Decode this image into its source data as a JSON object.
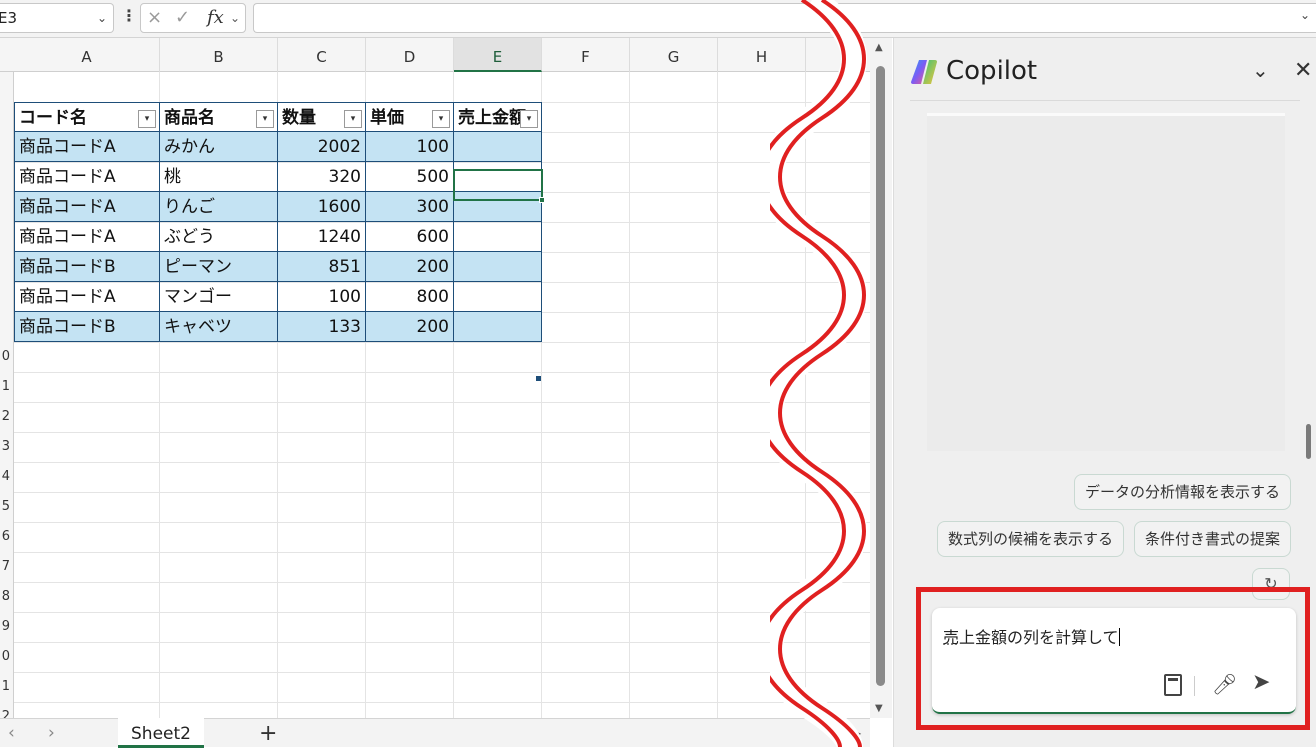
{
  "formula_bar": {
    "name_box": "E3",
    "cancel_icon": "×",
    "enter_icon": "✓",
    "fx_label": "fx",
    "formula": ""
  },
  "columns": [
    "A",
    "B",
    "C",
    "D",
    "E",
    "F",
    "G",
    "H"
  ],
  "row_numbers": [
    "",
    "",
    "",
    "",
    "",
    "",
    "",
    "",
    "0",
    "1",
    "2",
    "3",
    "4",
    "5",
    "6",
    "7",
    "8",
    "9",
    "0",
    "1",
    "2"
  ],
  "table": {
    "headers": [
      "コード名",
      "商品名",
      "数量",
      "単価",
      "売上金額"
    ],
    "rows": [
      [
        "商品コードA",
        "みかん",
        "2002",
        "100",
        ""
      ],
      [
        "商品コードA",
        "桃",
        "320",
        "500",
        ""
      ],
      [
        "商品コードA",
        "りんご",
        "1600",
        "300",
        ""
      ],
      [
        "商品コードA",
        "ぶどう",
        "1240",
        "600",
        ""
      ],
      [
        "商品コードB",
        "ピーマン",
        "851",
        "200",
        ""
      ],
      [
        "商品コードA",
        "マンゴー",
        "100",
        "800",
        ""
      ],
      [
        "商品コードB",
        "キャベツ",
        "133",
        "200",
        ""
      ]
    ],
    "band_color": "#c4e3f3",
    "border_color": "#1e4e79"
  },
  "sheets": {
    "active": "Sheet2",
    "add_label": "+"
  },
  "copilot": {
    "title": "Copilot",
    "suggestions": [
      "データの分析情報を表示する",
      "数式列の候補を表示する",
      "条件付き書式の提案"
    ],
    "input": {
      "underlined": "売",
      "rest": "上金額の列を計算して"
    }
  },
  "colors": {
    "excel_green": "#217346",
    "highlight_red": "#e02020"
  }
}
